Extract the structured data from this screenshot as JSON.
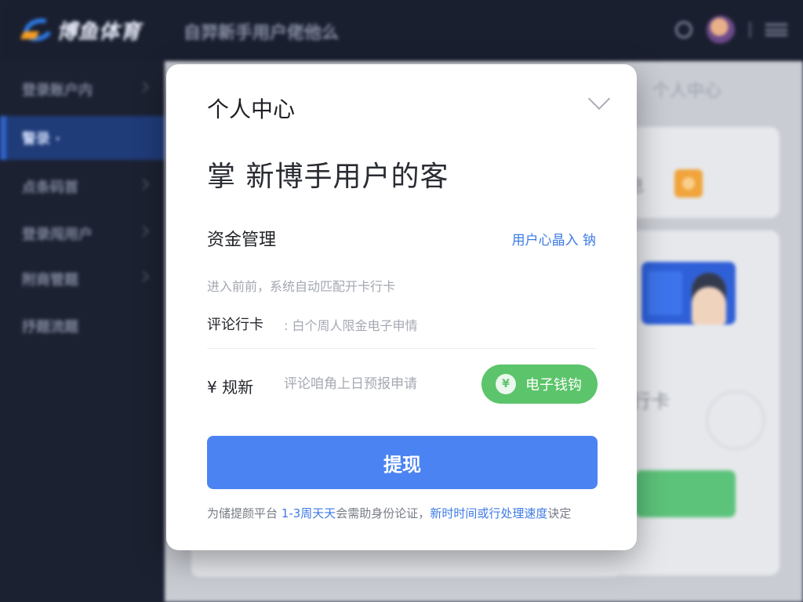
{
  "app": {
    "logo_text": "博鱼体育",
    "header_title": "自羿新手用户佬他么"
  },
  "sidebar": {
    "items": [
      {
        "label": "登录账户内"
      },
      {
        "label": "警录 ·"
      },
      {
        "label": "点条码首"
      },
      {
        "label": "登录闯用户"
      },
      {
        "label": "附商管题"
      },
      {
        "label": "抒题流题"
      }
    ]
  },
  "background": {
    "main_title": "个人中心",
    "card_label_1": "息",
    "card_label_2": "行卡"
  },
  "modal": {
    "title": "个人中心",
    "headline": "掌 新博手用户的客",
    "section_label": "资金管理",
    "section_link": "用户心晶入 钠",
    "hint": "进入前前，系统自动匹配开卡行卡",
    "card_row_label": "评论行卡",
    "card_row_value": ": 白个周人限金电子申情",
    "amount_label": "¥ 规新",
    "amount_placeholder": "评论咱角上日预报申请",
    "wallet_button": "电子钱钩",
    "wallet_icon_glyph": "¥",
    "submit_button": "提现",
    "note_prefix": "为储提颜平台",
    "note_highlight_1": "1-3周天天",
    "note_middle": "会需助身份论证，",
    "note_highlight_2": "新时时间或行处理速度",
    "note_suffix": "诀定"
  },
  "colors": {
    "primary": "#4b84f2",
    "wallet_green": "#5cc46a",
    "link_blue": "#3e7be6",
    "header_bg": "#1a1f30",
    "sidebar_active": "#1f3b78"
  }
}
